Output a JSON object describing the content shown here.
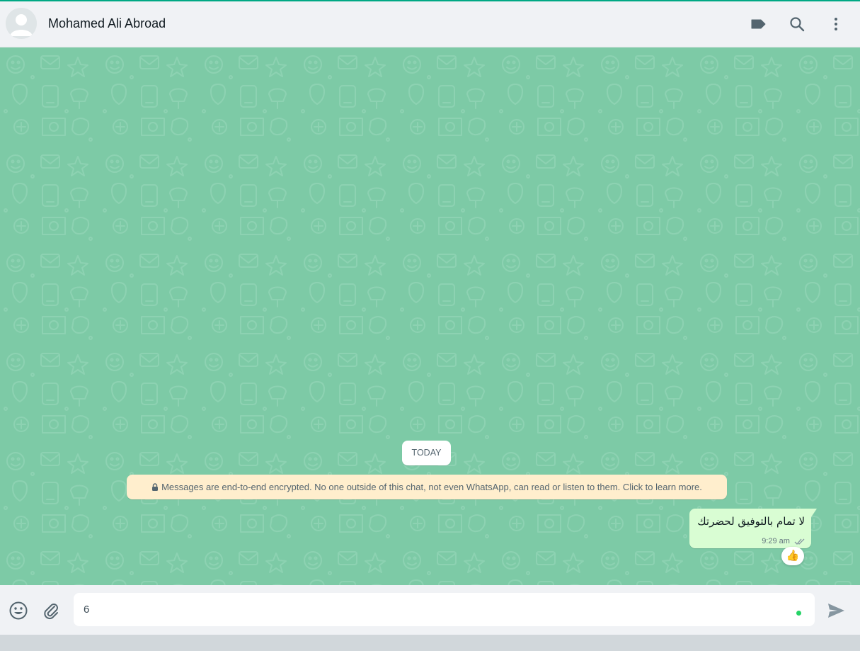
{
  "header": {
    "contact_name": "Mohamed Ali Abroad",
    "icons": [
      "label-icon",
      "search-icon",
      "menu-icon"
    ]
  },
  "chat": {
    "date_chip": "TODAY",
    "encryption_notice": "Messages are end-to-end encrypted. No one outside of this chat, not even WhatsApp, can read or listen to them. Click to learn more.",
    "messages": [
      {
        "direction": "outgoing",
        "text": "لا تمام بالتوفيق لحضرتك",
        "time": "9:29 am",
        "status": "delivered",
        "reaction": "👍"
      }
    ]
  },
  "composer": {
    "value": "6",
    "icons": [
      "emoji-icon",
      "attach-icon",
      "send-icon"
    ]
  },
  "colors": {
    "accent": "#00a884",
    "chat_background": "#7dcaa6",
    "outgoing_bubble": "#d9fdd3",
    "notice_background": "#ffeecd",
    "header_background": "#f0f2f5"
  }
}
